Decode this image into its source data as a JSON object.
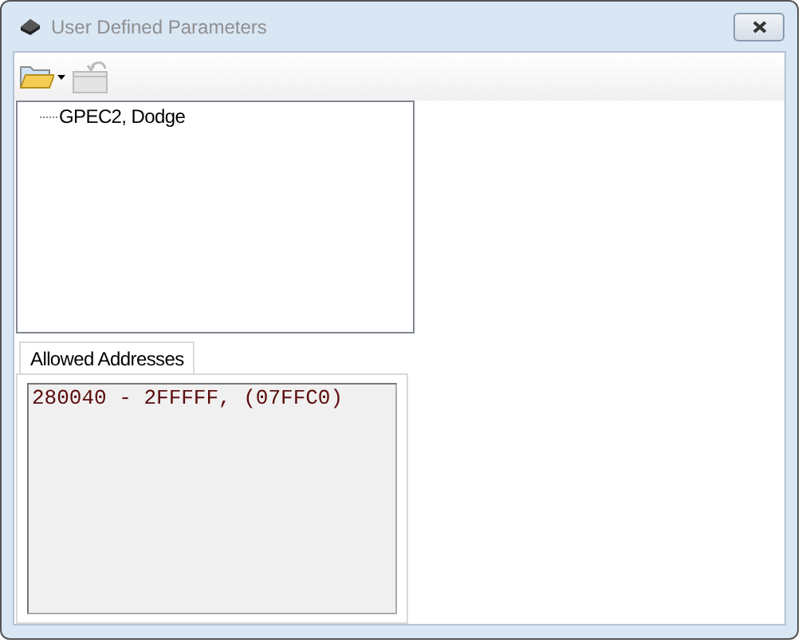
{
  "window": {
    "title": "User Defined Parameters"
  },
  "toolbar": {
    "buttons": [
      {
        "kind": "open",
        "disabled": false,
        "dropdown": true
      },
      {
        "kind": "back",
        "disabled": true,
        "dropdown": false
      }
    ]
  },
  "tree": {
    "items": [
      {
        "label": "GPEC2, Dodge"
      }
    ]
  },
  "tabs": [
    {
      "label": "Allowed Addresses",
      "selected": true
    }
  ],
  "addresses": {
    "value": "280040 - 2FFFFF, (07FFC0)"
  }
}
